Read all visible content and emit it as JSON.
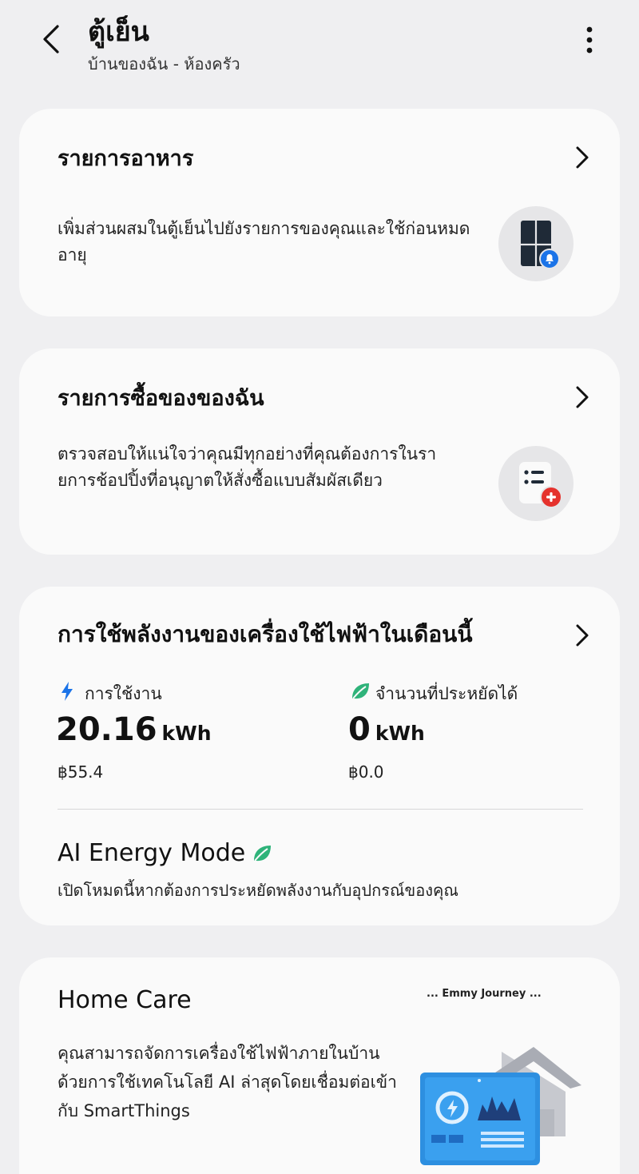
{
  "header": {
    "title": "ตู้เย็น",
    "subtitle": "บ้านของฉัน - ห้องครัว",
    "back_icon": "chevron-left-icon",
    "more_icon": "more-vertical-icon"
  },
  "food_list": {
    "title": "รายการอาหาร",
    "description": "เพิ่มส่วนผสมในตู้เย็นไปยังรายการของคุณและใช้ก่อนหมดอายุ",
    "icon": "fridge-bell-icon"
  },
  "shopping_list": {
    "title": "รายการซื้อของของฉัน",
    "description": "ตรวจสอบให้แน่ใจว่าคุณมีทุกอย่างที่คุณต้องการในรายการช้อปปิ้งที่อนุญาตให้สั่งซื้อแบบสัมผัสเดียว",
    "icon": "list-add-icon"
  },
  "energy": {
    "title": "การใช้พลังงานของเครื่องใช้ไฟฟ้าในเดือนนี้",
    "usage": {
      "label": "การใช้งาน",
      "value": "20.16",
      "unit": "kWh",
      "cost": "฿55.4"
    },
    "saved": {
      "label": "จำนวนที่ประหยัดได้",
      "value": "0",
      "unit": "kWh",
      "cost": "฿0.0"
    },
    "ai_mode": {
      "title": "AI Energy Mode",
      "description": "เปิดโหมดนี้หากต้องการประหยัดพลังงานกับอุปกรณ์ของคุณ"
    }
  },
  "home_care": {
    "title": "Home Care",
    "description": "คุณสามารถจัดการเครื่องใช้ไฟฟ้าภายในบ้านด้วยการใช้เทคโนโลยี AI ล่าสุดโดยเชื่อมต่อเข้ากับ SmartThings",
    "tag": "... Emmy Journey ..."
  },
  "colors": {
    "background": "#efeff1",
    "card": "#fafafa",
    "accent_blue": "#1a73e8",
    "leaf_green": "#2fb37a",
    "badge_red": "#e5322d"
  }
}
